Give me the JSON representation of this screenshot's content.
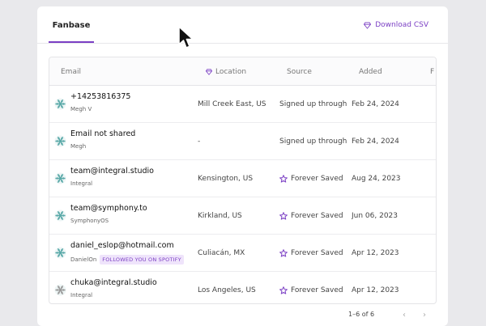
{
  "header": {
    "tab_label": "Fanbase",
    "download_label": "Download CSV"
  },
  "columns": {
    "email": "Email",
    "location": "Location",
    "source": "Source",
    "added": "Added",
    "partial": "F"
  },
  "rows": [
    {
      "email": "+14253816375",
      "name": "Megh V",
      "badge": "",
      "location": "Mill Creek East, US",
      "source": "Signed up through w",
      "source_star": false,
      "added": "Feb 24, 2024"
    },
    {
      "email": "Email not shared",
      "name": "Megh",
      "badge": "",
      "location": "-",
      "source": "Signed up through w",
      "source_star": false,
      "added": "Feb 24, 2024"
    },
    {
      "email": "team@integral.studio",
      "name": "Integral",
      "badge": "",
      "location": "Kensington, US",
      "source": "Forever Saved",
      "source_star": true,
      "added": "Aug 24, 2023"
    },
    {
      "email": "team@symphony.to",
      "name": "SymphonyOS",
      "badge": "",
      "location": "Kirkland, US",
      "source": "Forever Saved",
      "source_star": true,
      "added": "Jun 06, 2023"
    },
    {
      "email": "daniel_eslop@hotmail.com",
      "name": "DanielOn",
      "badge": "FOLLOWED YOU ON SPOTIFY",
      "location": "Culiacán, MX",
      "source": "Forever Saved",
      "source_star": true,
      "added": "Apr 12, 2023"
    },
    {
      "email": "chuka@integral.studio",
      "name": "Integral",
      "badge": "",
      "location": "Los Angeles, US",
      "source": "Forever Saved",
      "source_star": true,
      "added": "Apr 12, 2023"
    }
  ],
  "footer": {
    "pagination": "1–6 of 6",
    "prev_glyph": "‹",
    "next_glyph": "›"
  },
  "colors": {
    "accent": "#7b3fc4",
    "avatar_teal": "#5aa9a8",
    "avatar_gray": "#9a9a9a"
  }
}
